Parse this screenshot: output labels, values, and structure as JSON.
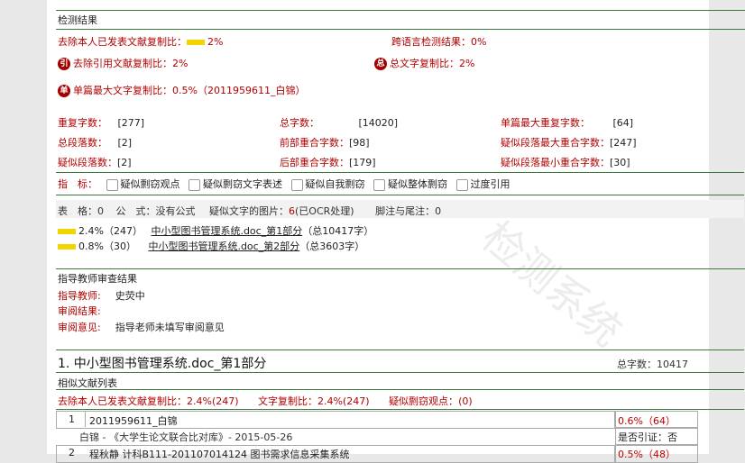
{
  "result": {
    "header": "检测结果",
    "excl_self_label": "去除本人已发表文献复制比：",
    "excl_self_value": "2%",
    "cross_lang_label": "跨语言检测结果：",
    "cross_lang_value": "0%",
    "excl_cite_label": "去除引用文献复制比：",
    "excl_cite_value": "2%",
    "total_text_label": "总文字复制比：",
    "total_text_value": "2%",
    "single_max_label": "单篇最大文字复制比：",
    "single_max_value": "0.5%",
    "single_max_src": "（2011959611_白锦）",
    "icon_cite": "引",
    "icon_total": "总",
    "icon_single": "单"
  },
  "stats": {
    "dup_chars_label": "重复字数：",
    "dup_chars": "[277]",
    "total_chars_label": "总字数：",
    "total_chars": "[14020]",
    "single_max_dup_label": "单篇最大重复字数：",
    "single_max_dup": "[64]",
    "total_paras_label": "总段落数：",
    "total_paras": "[2]",
    "front_overlap_label": "前部重合字数：",
    "front_overlap": "[98]",
    "sus_max_label": "疑似段落最大重合字数：",
    "sus_max": "[247]",
    "sus_paras_label": "疑似段落数：",
    "sus_paras": "[2]",
    "back_overlap_label": "后部重合字数：",
    "back_overlap": "[179]",
    "sus_min_label": "疑似段落最小重合字数：",
    "sus_min": "[30]"
  },
  "indicators": {
    "label": "指　标：",
    "items": [
      "疑似剽窃观点",
      "疑似剽窃文字表述",
      "疑似自我剽窃",
      "疑似整体剽窃",
      "过度引用"
    ]
  },
  "misc": {
    "tables": "表　格：0",
    "formulas": "公　式：没有公式",
    "images_label": "疑似文字的图片：",
    "images_value": "6",
    "images_note": "(已OCR处理)",
    "footnotes": "脚注与尾注：0"
  },
  "parts": [
    {
      "pct": "2.4%（247）",
      "name": "中小型图书管理系统.doc_第1部分",
      "total": "（总10417字）"
    },
    {
      "pct": "0.8%（30）",
      "name": "中小型图书管理系统.doc_第2部分",
      "total": "（总3603字）"
    }
  ],
  "review": {
    "header": "指导教师审查结果",
    "teacher_label": "指导教师:",
    "teacher": "史荧中",
    "result_label": "审阅结果:",
    "opinion_label": "审阅意见:",
    "opinion": "指导老师未填写审阅意见"
  },
  "section1": {
    "title": "1. 中小型图书管理系统.doc_第1部分",
    "total": "总字数：10417",
    "list_header": "相似文献列表",
    "excl_label": "去除本人已发表文献复制比：",
    "excl_value": "2.4%(247)",
    "text_copy_label": "文字复制比：",
    "text_copy_value": "2.4%(247)",
    "sus_label": "疑似剽窃观点：",
    "sus_value": "(0)",
    "rows": [
      {
        "no": "1",
        "title": "2011959611_白锦",
        "pct": "0.6%（64）",
        "sub": "白锦 - 《大学生论文联合比对库》- 2015-05-26",
        "cite": "是否引证：否"
      },
      {
        "no": "2",
        "title": "程秋静 计科B111-201107014124 图书需求信息采集系统",
        "pct": "0.5%（48）"
      }
    ]
  },
  "watermark": "检测系统",
  "colors": {
    "accent_green": "#3a7a3a",
    "red": "#b30000",
    "bar_yellow": "#f2d400"
  }
}
